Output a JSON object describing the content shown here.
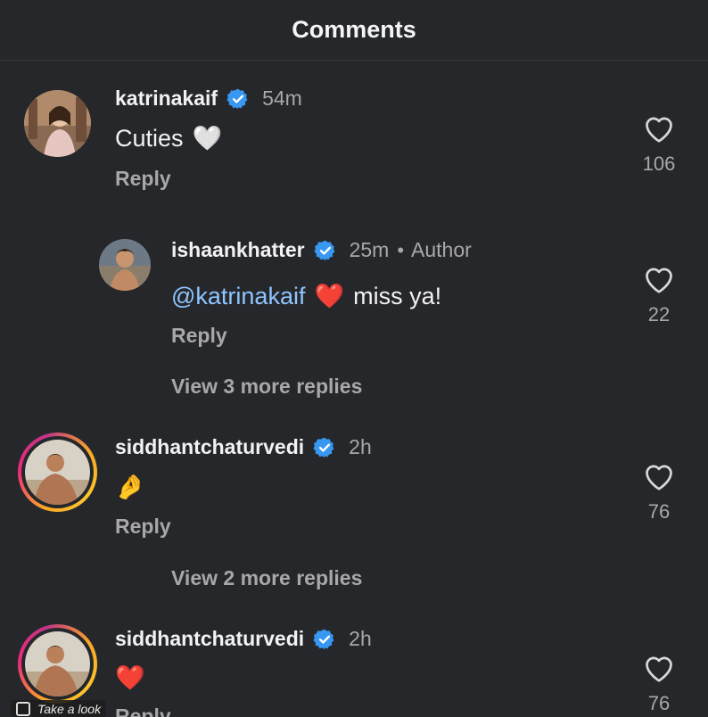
{
  "header": {
    "title": "Comments"
  },
  "comments": [
    {
      "username": "katrinakaif",
      "time": "54m",
      "text": "Cuties",
      "emoji": "🤍",
      "reply_label": "Reply",
      "likes": "106"
    },
    {
      "username": "ishaankhatter",
      "time": "25m",
      "author_badge": "Author",
      "mention": "@katrinakaif",
      "emoji": "❤️",
      "text": "miss ya!",
      "reply_label": "Reply",
      "likes": "22",
      "view_more": "View 3 more replies"
    },
    {
      "username": "siddhantchaturvedi",
      "time": "2h",
      "emoji": "🤌",
      "reply_label": "Reply",
      "likes": "76",
      "view_more": "View 2 more replies"
    },
    {
      "username": "siddhantchaturvedi",
      "time": "2h",
      "emoji": "❤️",
      "reply_label": "Reply",
      "likes": "76"
    }
  ],
  "overlay": {
    "chip_text": "Take a look"
  },
  "icons": {
    "verified": "verified-badge-icon",
    "like": "heart-outline-icon"
  },
  "colors": {
    "background": "#25272b",
    "verified": "#3897f0",
    "mention": "#8ec5ff",
    "muted": "#a8a8a8"
  }
}
